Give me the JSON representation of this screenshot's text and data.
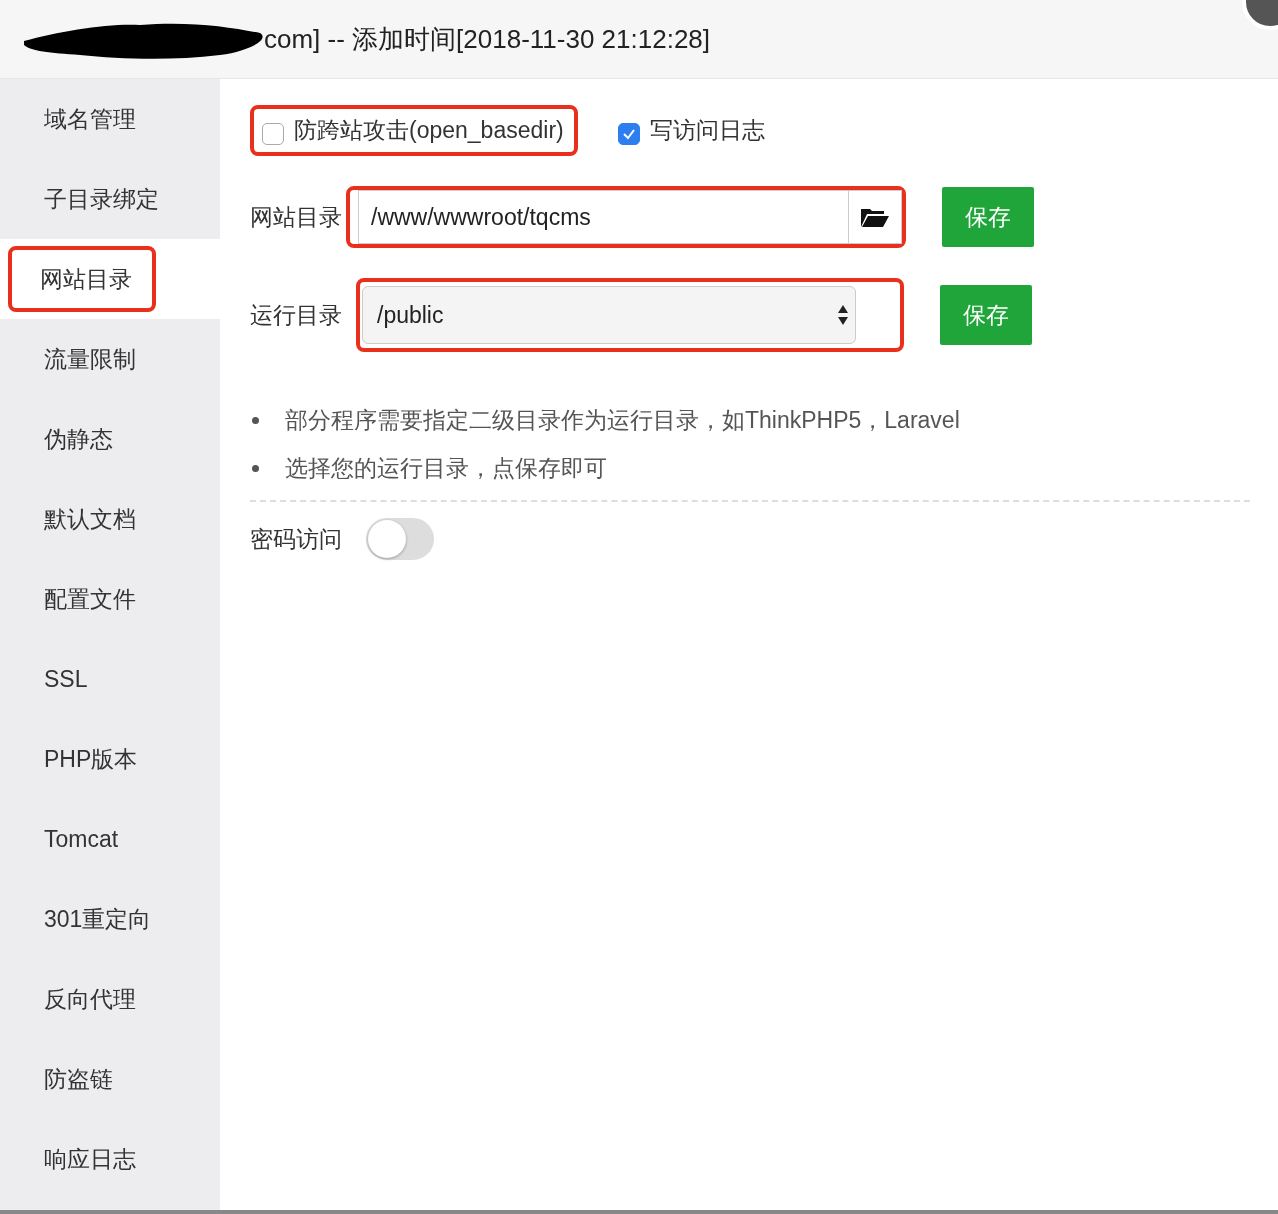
{
  "window": {
    "title": "com] -- 添加时间[2018-11-30 21:12:28]",
    "redacted": true
  },
  "sidebar": {
    "items": [
      {
        "label": "域名管理",
        "selected": false,
        "highlighted": false
      },
      {
        "label": "子目录绑定",
        "selected": false,
        "highlighted": false
      },
      {
        "label": "网站目录",
        "selected": true,
        "highlighted": true
      },
      {
        "label": "流量限制",
        "selected": false,
        "highlighted": false
      },
      {
        "label": "伪静态",
        "selected": false,
        "highlighted": false
      },
      {
        "label": "默认文档",
        "selected": false,
        "highlighted": false
      },
      {
        "label": "配置文件",
        "selected": false,
        "highlighted": false
      },
      {
        "label": "SSL",
        "selected": false,
        "highlighted": false
      },
      {
        "label": "PHP版本",
        "selected": false,
        "highlighted": false
      },
      {
        "label": "Tomcat",
        "selected": false,
        "highlighted": false
      },
      {
        "label": "301重定向",
        "selected": false,
        "highlighted": false
      },
      {
        "label": "反向代理",
        "selected": false,
        "highlighted": false
      },
      {
        "label": "防盗链",
        "selected": false,
        "highlighted": false
      },
      {
        "label": "响应日志",
        "selected": false,
        "highlighted": false
      }
    ]
  },
  "options": [
    {
      "label": "防跨站攻击(open_basedir)",
      "checked": false,
      "highlighted": true
    },
    {
      "label": "写访问日志",
      "checked": true,
      "highlighted": false
    }
  ],
  "fields": [
    {
      "kind": "path",
      "label": "网站目录",
      "value": "/www/wwwroot/tqcms",
      "highlighted": true,
      "button": "保存"
    },
    {
      "kind": "select",
      "label": "运行目录",
      "value": "/public",
      "highlighted": true,
      "button": "保存"
    }
  ],
  "notes": [
    "部分程序需要指定二级目录作为运行目录，如ThinkPHP5，Laravel",
    "选择您的运行目录，点保存即可"
  ],
  "password_access": {
    "label": "密码访问",
    "on": false
  }
}
